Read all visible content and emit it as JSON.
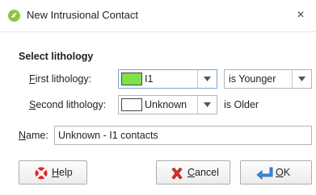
{
  "window": {
    "title": "New Intrusional Contact",
    "app_icon": "leapfrog-app-icon",
    "close_glyph": "×"
  },
  "lithology": {
    "group_label": "Select lithology",
    "first": {
      "label_accel": "F",
      "label_rest": "irst lithology:",
      "value": "I1",
      "swatch_color": "#7ee24a",
      "relation": "is Younger"
    },
    "second": {
      "label_accel": "S",
      "label_rest": "econd lithology:",
      "value": "Unknown",
      "swatch_color": "#ffffff",
      "relation_text": "is Older"
    }
  },
  "name": {
    "label_accel": "N",
    "label_rest": "ame:",
    "value": "Unknown - I1 contacts"
  },
  "buttons": {
    "help": {
      "accel": "H",
      "rest": "elp",
      "icon": "help-lifebuoy-icon"
    },
    "cancel": {
      "accel": "C",
      "rest": "ancel",
      "icon": "red-x-icon"
    },
    "ok": {
      "accel": "O",
      "rest": "K",
      "icon": "enter-arrow-icon"
    }
  },
  "colors": {
    "accent_focus": "#7aa7d6",
    "app_icon_green": "#8cc63f"
  }
}
